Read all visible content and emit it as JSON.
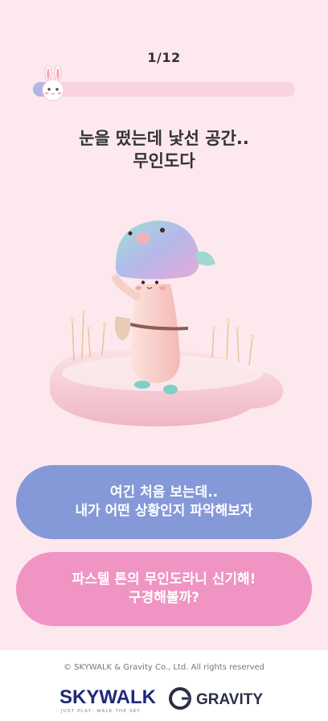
{
  "progress": {
    "label": "1/12",
    "current": 1,
    "total": 12,
    "fraction": 0.083
  },
  "question": {
    "line1": "눈을 떴는데 낯선 공간..",
    "line2": "무인도다"
  },
  "answers": [
    {
      "line1": "여긴 처음 보는데..",
      "line2": "내가 어떤 상황인지 파악해보자",
      "color": "#8598d8"
    },
    {
      "line1": "파스텔 톤의 무인도라니 신기해!",
      "line2": "구경해볼까?",
      "color": "#ef94c3"
    }
  ],
  "illustration": {
    "icon": "mushroom-character-on-island"
  },
  "footer": {
    "copyright": "© SKYWALK & Gravity Co., Ltd. All rights reserved",
    "skywalk_logo_text": "SKYWALK",
    "skywalk_tagline": "JUST PLAY, WALK THE SKY.",
    "gravity_logo_text": "GRAVITY"
  },
  "colors": {
    "background": "#fde8ee",
    "answer_primary": "#8598d8",
    "answer_secondary": "#ef94c3"
  }
}
